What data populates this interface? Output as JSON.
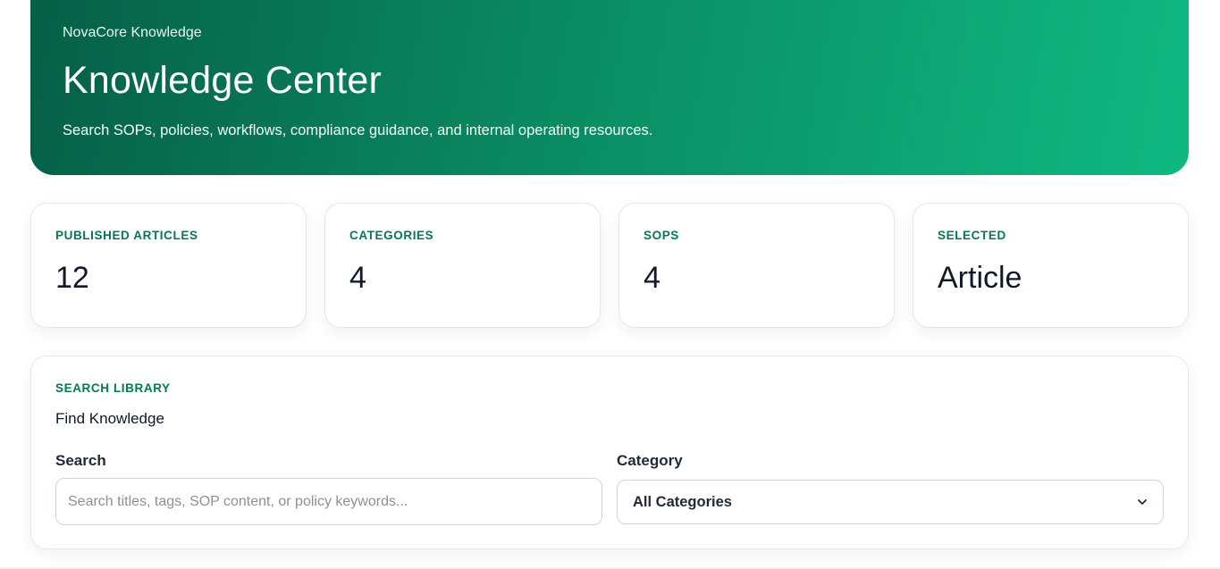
{
  "hero": {
    "eyebrow": "NovaCore Knowledge",
    "title": "Knowledge Center",
    "subtitle": "Search SOPs, policies, workflows, compliance guidance, and internal operating resources."
  },
  "stats": [
    {
      "label": "PUBLISHED ARTICLES",
      "value": "12"
    },
    {
      "label": "CATEGORIES",
      "value": "4"
    },
    {
      "label": "SOPS",
      "value": "4"
    },
    {
      "label": "SELECTED",
      "value": "Article"
    }
  ],
  "search_panel": {
    "eyebrow": "SEARCH LIBRARY",
    "title": "Find Knowledge",
    "search_label": "Search",
    "search_placeholder": "Search titles, tags, SOP content, or policy keywords...",
    "search_value": "",
    "category_label": "Category",
    "category_selected": "All Categories"
  },
  "colors": {
    "accent": "#047857",
    "hero_start": "#065f46",
    "hero_end": "#10b981"
  },
  "icons": {
    "category_dropdown": "chevron-down-icon"
  }
}
